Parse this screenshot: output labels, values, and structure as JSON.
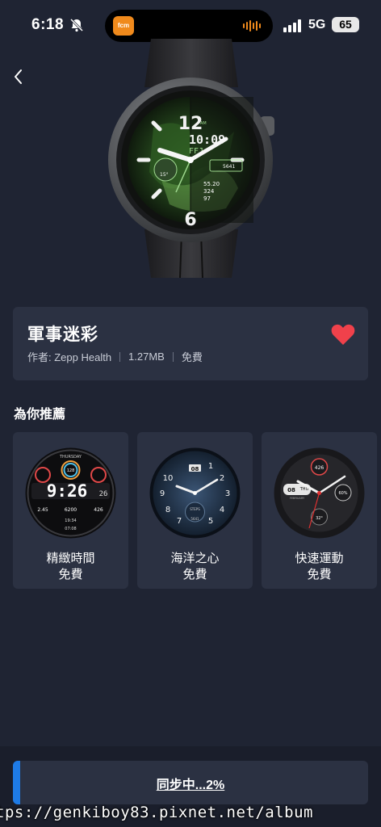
{
  "status_bar": {
    "time": "6:18",
    "island_app": "fcm",
    "network": "5G",
    "battery": "65"
  },
  "watch_face": {
    "title": "軍事迷彩",
    "author": "作者: Zepp Health",
    "size": "1.27MB",
    "price": "免費",
    "favorited": true,
    "preview": {
      "time": "10:09",
      "date_code": "FFJ",
      "temp": "15°",
      "steps": "5641",
      "stat_1": "55.20",
      "stat_2": "324",
      "stat_3": "97",
      "hour_top": "12",
      "hour_bottom": "6",
      "am": "AM"
    }
  },
  "recommendations": {
    "title": "為你推薦",
    "items": [
      {
        "name": "精緻時間",
        "price": "免費",
        "face_time": "9:26",
        "face_sec": "26",
        "day": "THURSDAY",
        "vals": [
          "2.45",
          "6200",
          "426"
        ],
        "bottom": "19:34",
        "bottom2": "07:08",
        "ring": "128"
      },
      {
        "name": "海洋之心",
        "price": "免費",
        "date": "08",
        "steps_label": "STEPS",
        "steps": "5641"
      },
      {
        "name": "快速運動",
        "price": "免費",
        "date": "08",
        "day": "THU",
        "month": "FEBRUARY",
        "pct": "60%",
        "temp": "32°",
        "top_val": "426"
      }
    ]
  },
  "sync": {
    "label": "同步中...2%",
    "progress": 0.02
  },
  "watermark": "tps://genkiboy83.pixnet.net/album",
  "colors": {
    "background": "#1f2433",
    "card": "#2b3142",
    "accent": "#1e7be6",
    "heart": "#f0414b",
    "camo_green": "#4a8a3a"
  }
}
